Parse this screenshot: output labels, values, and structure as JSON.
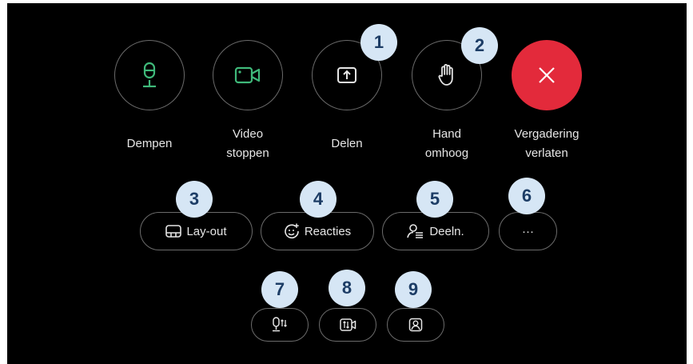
{
  "main_controls": {
    "mute_label": "Dempen",
    "video_label_line1": "Video",
    "video_label_line2": "stoppen",
    "share_label": "Delen",
    "hand_label_line1": "Hand",
    "hand_label_line2": "omhoog",
    "leave_label_line1": "Vergadering",
    "leave_label_line2": "verlaten"
  },
  "secondary_controls": {
    "layout_label": "Lay-out",
    "reactions_label": "Reacties",
    "participants_label": "Deeln.",
    "more_label": "···"
  },
  "badges": [
    "1",
    "2",
    "3",
    "4",
    "5",
    "6",
    "7",
    "8",
    "9"
  ],
  "icons": {
    "mute": "microphone-icon",
    "video": "video-camera-icon",
    "share": "share-upload-icon",
    "hand": "raise-hand-icon",
    "leave": "close-x-icon",
    "layout": "layout-icon",
    "reactions": "emoji-plus-icon",
    "participants": "participants-list-icon",
    "audio_settings": "microphone-settings-icon",
    "video_settings": "video-settings-icon",
    "self_view": "self-view-icon"
  },
  "colors": {
    "background": "#000000",
    "accent_green": "#3fb97a",
    "leave_red": "#e32a3b",
    "badge_bg": "#d6e6f5",
    "badge_text": "#1d3d66"
  }
}
